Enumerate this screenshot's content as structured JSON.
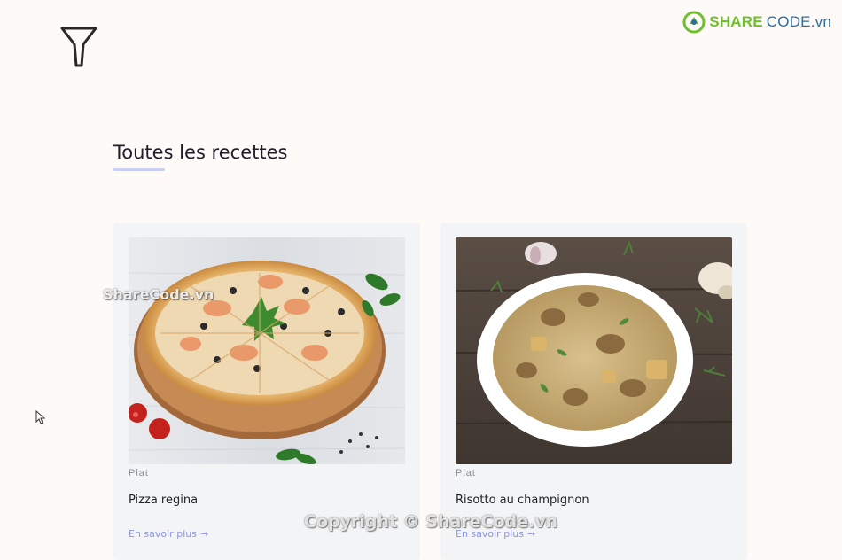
{
  "toolbar": {
    "filter_icon": "filter-funnel-icon"
  },
  "brand": {
    "name_part1": "SHARE",
    "name_part2": "CODE.vn",
    "accent_color": "#6fbf2e",
    "secondary_color": "#2d6f9f"
  },
  "section": {
    "title": "Toutes les recettes",
    "underline_color": "#c9d0f3"
  },
  "recipes": [
    {
      "image_icon": "pizza-photo",
      "category": "Plat",
      "title": "Pizza regina",
      "link_label": "En savoir plus",
      "link_arrow": "→"
    },
    {
      "image_icon": "risotto-photo",
      "category": "Plat",
      "title": "Risotto au champignon",
      "link_label": "En savoir plus",
      "link_arrow": "→"
    }
  ],
  "watermarks": {
    "image_text": "ShareCode.vn",
    "footer_text": "Copyright © ShareCode.vn"
  },
  "colors": {
    "background": "#fdfaf8",
    "card_background": "#f3f4f6",
    "link": "#8c95e6"
  }
}
